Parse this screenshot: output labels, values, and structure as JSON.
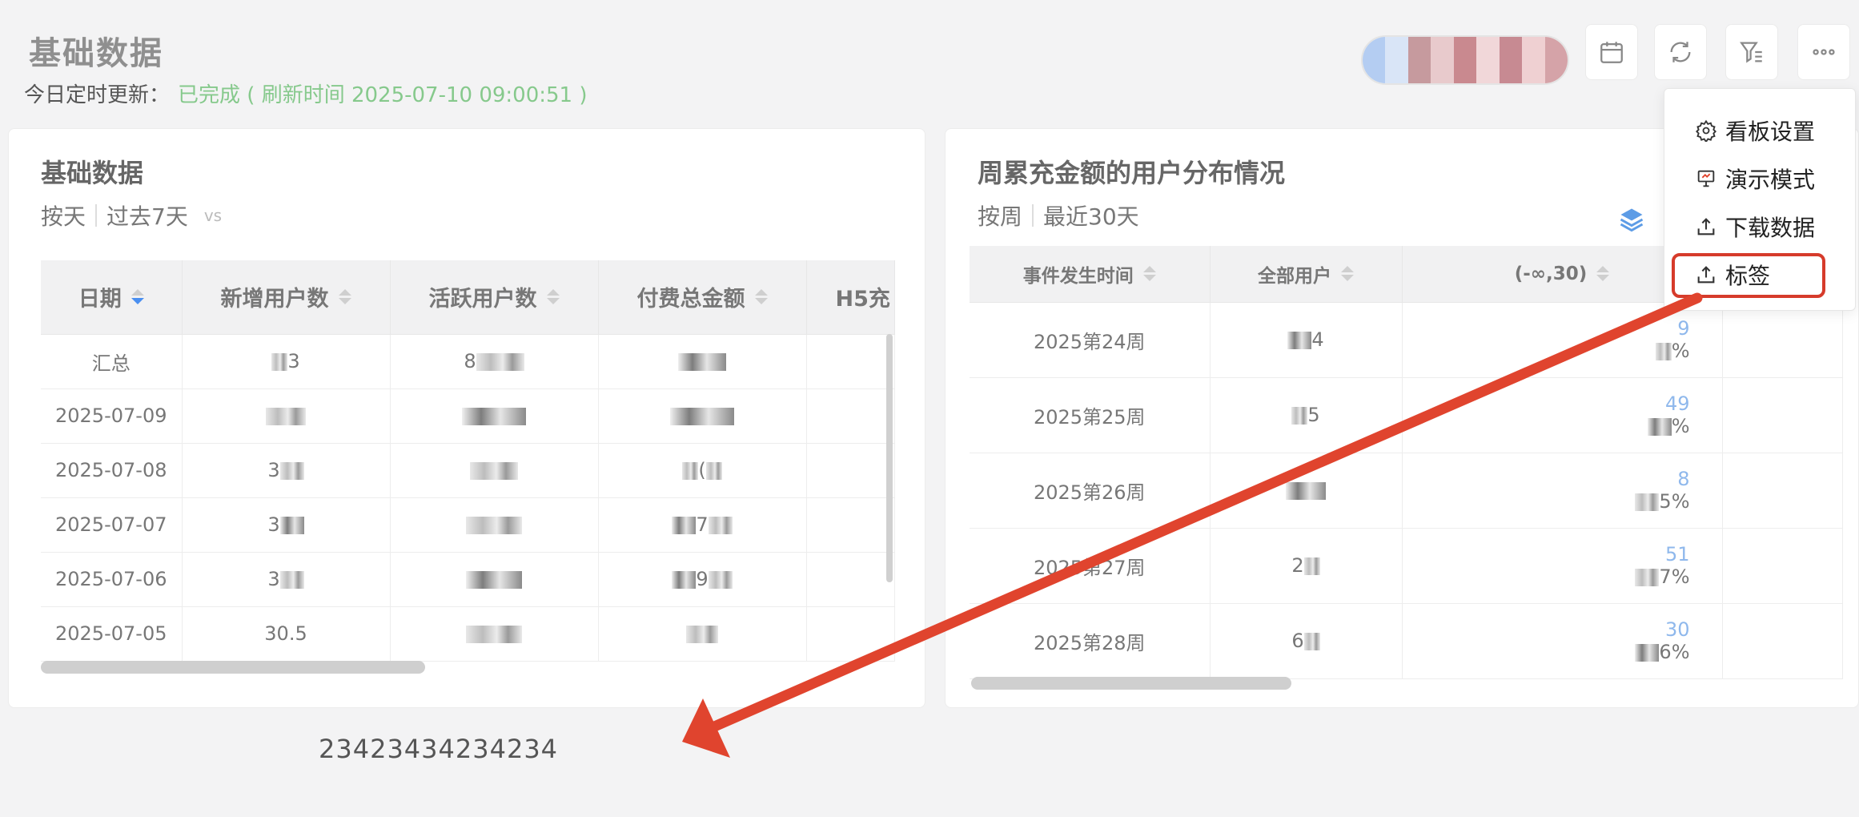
{
  "header": {
    "title": "基础数据",
    "update_label": "今日定时更新：",
    "update_status": "已完成 ( 刷新时间 2025-07-10 09:00:51 )"
  },
  "toolbar": {
    "buttons": [
      "calendar-icon",
      "refresh-icon",
      "filter-icon",
      "more-icon"
    ]
  },
  "left_card": {
    "title": "基础数据",
    "granularity": "按天",
    "range": "过去7天",
    "compare": "vs",
    "columns": [
      "日期",
      "新增用户数",
      "活跃用户数",
      "付费总金额",
      "H5充"
    ],
    "rows": [
      [
        "汇总",
        "3",
        "8",
        "",
        ""
      ],
      [
        "2025-07-09",
        "",
        "",
        "",
        ""
      ],
      [
        "2025-07-08",
        "3",
        "",
        "(",
        ""
      ],
      [
        "2025-07-07",
        "3",
        "",
        "7",
        ""
      ],
      [
        "2025-07-06",
        "3",
        "",
        "9",
        ""
      ],
      [
        "2025-07-05",
        "30.5",
        "",
        "",
        ""
      ]
    ]
  },
  "right_card": {
    "title": "周累充金额的用户分布情况",
    "granularity": "按周",
    "range": "最近30天",
    "columns": [
      "事件发生时间",
      "全部用户",
      "(-∞,30)"
    ],
    "rows": [
      {
        "week": "2025第24周",
        "all": "4",
        "top": "9",
        "pct": "%"
      },
      {
        "week": "2025第25周",
        "all": "5",
        "top": "49",
        "pct": "%"
      },
      {
        "week": "2025第26周",
        "all": "",
        "top": "8",
        "pct": "5%"
      },
      {
        "week": "2025第27周",
        "all": "2",
        "top": "51",
        "pct": "7%"
      },
      {
        "week": "2025第28周",
        "all": "6",
        "top": "30",
        "pct": "6%"
      }
    ]
  },
  "menu": {
    "items": [
      "看板设置",
      "演示模式",
      "下载数据",
      "标签"
    ]
  },
  "annotation": {
    "number": "23423434234234",
    "color": "#e0442e"
  }
}
